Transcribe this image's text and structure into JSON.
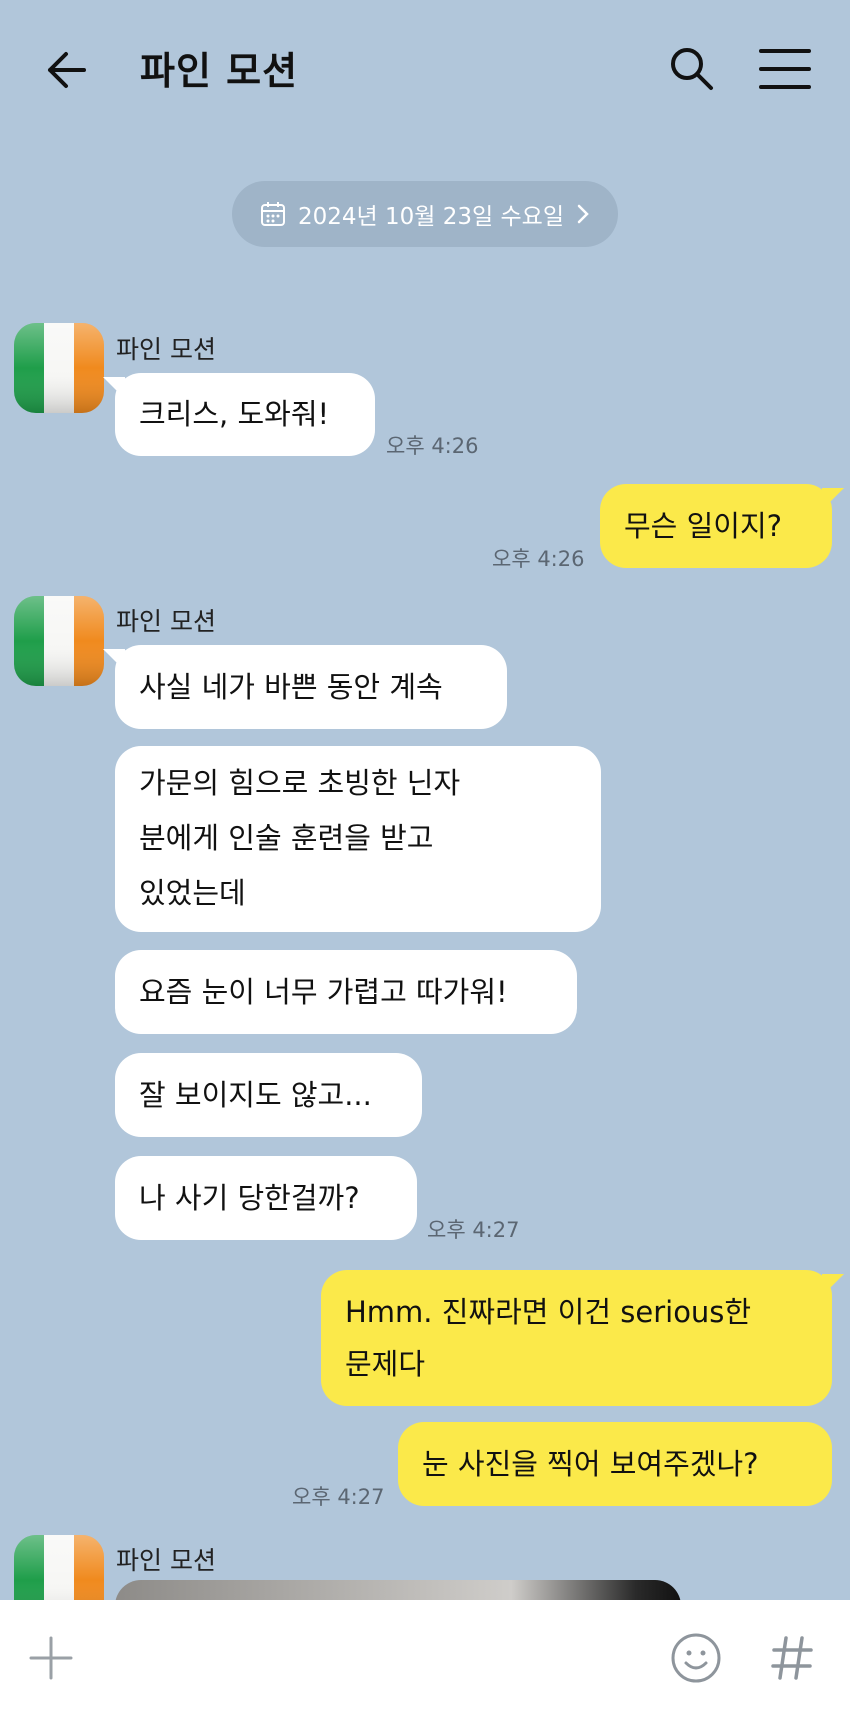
{
  "header": {
    "title": "파인 모션",
    "back_icon": "arrow-left-icon",
    "search_icon": "search-icon",
    "menu_icon": "hamburger-menu-icon"
  },
  "date_divider": {
    "label": "2024년 10월 23일 수요일",
    "icon": "calendar-icon",
    "chevron": "chevron-right-icon"
  },
  "messages": [
    {
      "type": "in",
      "sender": "파인 모션",
      "text": "크리스, 도와줘!",
      "time": "오후 4:26"
    },
    {
      "type": "out",
      "text": "무슨 일이지?",
      "time": "오후 4:26"
    },
    {
      "type": "in",
      "sender": "파인 모션",
      "text": "사실 네가 바쁜 동안 계속"
    },
    {
      "type": "in",
      "lines": [
        "가문의 힘으로 초빙한 닌자",
        "분에게 인술 훈련을 받고",
        "있었는데"
      ]
    },
    {
      "type": "in",
      "text": "요즘 눈이 너무 가렵고 따가워!"
    },
    {
      "type": "in",
      "text": "잘 보이지도 않고..."
    },
    {
      "type": "in",
      "text": "나 사기 당한걸까?",
      "time": "오후 4:27"
    },
    {
      "type": "out",
      "lines": [
        "Hmm. 진짜라면 이건 serious한",
        "문제다"
      ]
    },
    {
      "type": "out",
      "text": "눈 사진을 찍어 보여주겠나?",
      "time": "오후 4:27"
    },
    {
      "type": "in",
      "sender": "파인 모션",
      "image": true
    }
  ],
  "input_bar": {
    "plus_icon": "plus-icon",
    "emoji_icon": "emoji-icon",
    "hash_icon": "hashtag-icon"
  },
  "colors": {
    "background": "#b1c6da",
    "incoming_bubble": "#ffffff",
    "outgoing_bubble": "#fbe94a",
    "date_pill": "#9fb4c8"
  }
}
